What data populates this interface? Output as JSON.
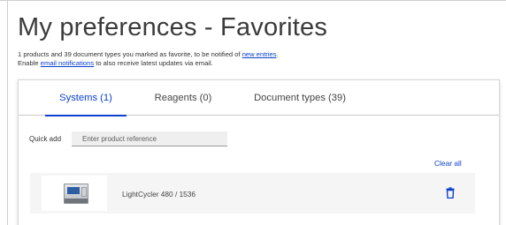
{
  "page": {
    "title": "My preferences - Favorites",
    "intro": {
      "line1_text": "1 products and 39 document types you marked as favorite, to be notified of ",
      "line1_link": "new entries",
      "line1_end": ".",
      "line2_start": "Enable ",
      "line2_link": "email notifications",
      "line2_text": " to also receive latest updates via email."
    }
  },
  "tabs": [
    {
      "label": "Systems (1)",
      "active": true
    },
    {
      "label": "Reagents (0)",
      "active": false
    },
    {
      "label": "Document types (39)",
      "active": false
    }
  ],
  "quick_add": {
    "label": "Quick add",
    "placeholder": "Enter product reference",
    "value": ""
  },
  "clear_all_label": "Clear all",
  "products": [
    {
      "name": "LightCycler 480 / 1536",
      "icon": "trash-icon"
    }
  ],
  "colors": {
    "accent": "#0b41cd",
    "row_background": "#f5f5f5",
    "input_background": "#efefef"
  }
}
